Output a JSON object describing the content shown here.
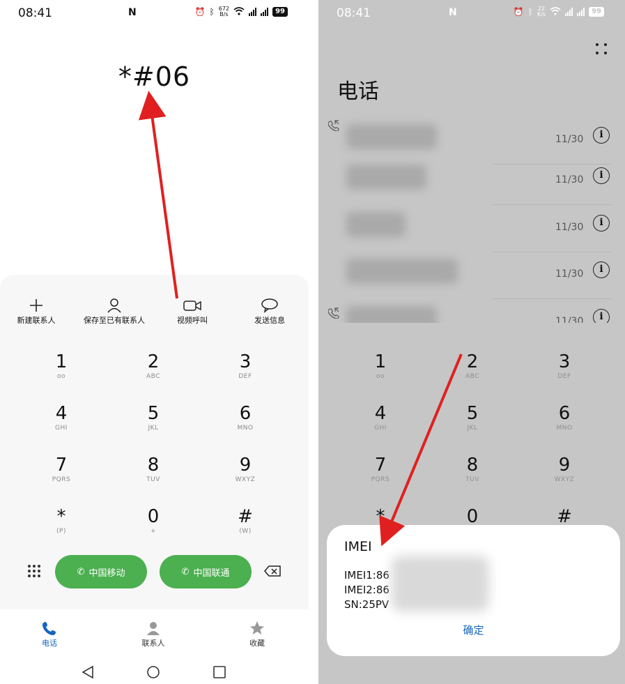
{
  "left": {
    "status": {
      "time": "08:41",
      "net_speed": "672",
      "net_unit": "B/s",
      "battery": "99"
    },
    "dialed_number": "*#06",
    "actions": [
      {
        "label": "新建联系人",
        "icon": "plus-icon"
      },
      {
        "label": "保存至已有联系人",
        "icon": "person-icon"
      },
      {
        "label": "视频呼叫",
        "icon": "video-icon"
      },
      {
        "label": "发送信息",
        "icon": "message-icon"
      }
    ],
    "keys": [
      {
        "digit": "1",
        "letters": "oo"
      },
      {
        "digit": "2",
        "letters": "ABC"
      },
      {
        "digit": "3",
        "letters": "DEF"
      },
      {
        "digit": "4",
        "letters": "GHI"
      },
      {
        "digit": "5",
        "letters": "JKL"
      },
      {
        "digit": "6",
        "letters": "MNO"
      },
      {
        "digit": "7",
        "letters": "PQRS"
      },
      {
        "digit": "8",
        "letters": "TUV"
      },
      {
        "digit": "9",
        "letters": "WXYZ"
      },
      {
        "digit": "*",
        "letters": "(P)"
      },
      {
        "digit": "0",
        "letters": "+"
      },
      {
        "digit": "#",
        "letters": "(W)"
      }
    ],
    "call_buttons": [
      {
        "label": "中国移动"
      },
      {
        "label": "中国联通"
      }
    ],
    "tabs": [
      {
        "label": "电话"
      },
      {
        "label": "联系人"
      },
      {
        "label": "收藏"
      }
    ]
  },
  "right": {
    "status": {
      "time": "08:41",
      "net_speed": "22",
      "net_unit": "K/s",
      "battery": "99"
    },
    "title": "电话",
    "call_log": [
      {
        "date": "11/30"
      },
      {
        "date": "11/30"
      },
      {
        "date": "11/30"
      },
      {
        "date": "11/30"
      },
      {
        "date": "11/30"
      }
    ],
    "keys": [
      {
        "digit": "1",
        "letters": "oo"
      },
      {
        "digit": "2",
        "letters": "ABC"
      },
      {
        "digit": "3",
        "letters": "DEF"
      },
      {
        "digit": "4",
        "letters": "GHI"
      },
      {
        "digit": "5",
        "letters": "JKL"
      },
      {
        "digit": "6",
        "letters": "MNO"
      },
      {
        "digit": "7",
        "letters": "PQRS"
      },
      {
        "digit": "8",
        "letters": "TUV"
      },
      {
        "digit": "9",
        "letters": "WXYZ"
      },
      {
        "digit": "*",
        "letters": ""
      },
      {
        "digit": "0",
        "letters": ""
      },
      {
        "digit": "#",
        "letters": ""
      }
    ],
    "dialog": {
      "title": "IMEI",
      "lines": [
        "IMEI1:86",
        "IMEI2:86",
        "SN:25PV"
      ],
      "confirm": "确定"
    }
  },
  "colors": {
    "accent": "#1565c0",
    "call_green": "#4caf50",
    "arrow_red": "#e02020",
    "dim_overlay": "#c6c6c6"
  }
}
